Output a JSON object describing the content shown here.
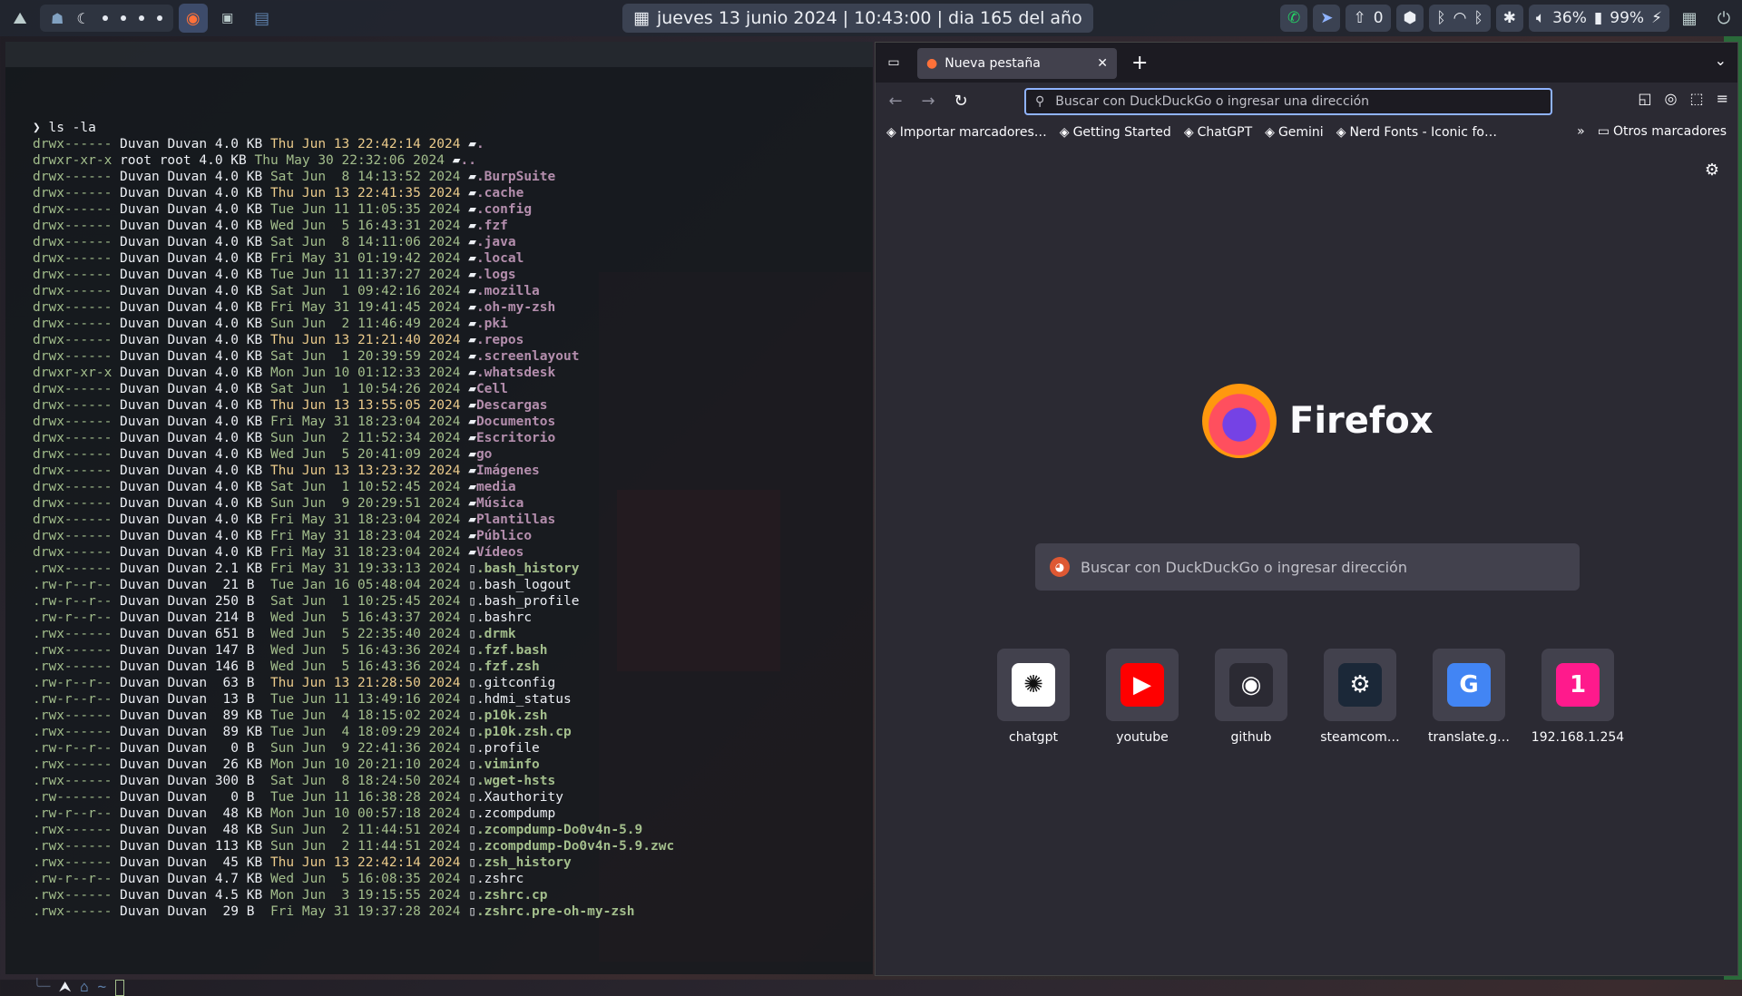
{
  "topbar": {
    "clock": "jueves 13 junio 2024 |  10:43:00 |  dia 165 del año",
    "notifications_count": "0",
    "volume": "36%",
    "battery": "99%"
  },
  "terminal": {
    "command": "❯ ls -la",
    "rows": [
      {
        "perm": "drwx------",
        "owner": "Duvan",
        "group": "Duvan",
        "size": "4.0 KB",
        "date": "Thu Jun 13 22:42:14 2024",
        "name": ".",
        "kind": "dir",
        "today": true
      },
      {
        "perm": "drwxr-xr-x",
        "owner": "root",
        "group": "root",
        "size": "4.0 KB",
        "date": "Thu May 30 22:32:06 2024",
        "name": "..",
        "kind": "dir"
      },
      {
        "perm": "drwx------",
        "owner": "Duvan",
        "group": "Duvan",
        "size": "4.0 KB",
        "date": "Sat Jun  8 14:13:52 2024",
        "name": ".BurpSuite",
        "kind": "dir"
      },
      {
        "perm": "drwx------",
        "owner": "Duvan",
        "group": "Duvan",
        "size": "4.0 KB",
        "date": "Thu Jun 13 22:41:35 2024",
        "name": ".cache",
        "kind": "dir",
        "today": true
      },
      {
        "perm": "drwx------",
        "owner": "Duvan",
        "group": "Duvan",
        "size": "4.0 KB",
        "date": "Tue Jun 11 11:05:35 2024",
        "name": ".config",
        "kind": "dir"
      },
      {
        "perm": "drwx------",
        "owner": "Duvan",
        "group": "Duvan",
        "size": "4.0 KB",
        "date": "Wed Jun  5 16:43:31 2024",
        "name": ".fzf",
        "kind": "dir"
      },
      {
        "perm": "drwx------",
        "owner": "Duvan",
        "group": "Duvan",
        "size": "4.0 KB",
        "date": "Sat Jun  8 14:11:06 2024",
        "name": ".java",
        "kind": "dir"
      },
      {
        "perm": "drwx------",
        "owner": "Duvan",
        "group": "Duvan",
        "size": "4.0 KB",
        "date": "Fri May 31 01:19:42 2024",
        "name": ".local",
        "kind": "dir"
      },
      {
        "perm": "drwx------",
        "owner": "Duvan",
        "group": "Duvan",
        "size": "4.0 KB",
        "date": "Tue Jun 11 11:37:27 2024",
        "name": ".logs",
        "kind": "dir"
      },
      {
        "perm": "drwx------",
        "owner": "Duvan",
        "group": "Duvan",
        "size": "4.0 KB",
        "date": "Sat Jun  1 09:42:16 2024",
        "name": ".mozilla",
        "kind": "dir"
      },
      {
        "perm": "drwx------",
        "owner": "Duvan",
        "group": "Duvan",
        "size": "4.0 KB",
        "date": "Fri May 31 19:41:45 2024",
        "name": ".oh-my-zsh",
        "kind": "dir"
      },
      {
        "perm": "drwx------",
        "owner": "Duvan",
        "group": "Duvan",
        "size": "4.0 KB",
        "date": "Sun Jun  2 11:46:49 2024",
        "name": ".pki",
        "kind": "dir"
      },
      {
        "perm": "drwx------",
        "owner": "Duvan",
        "group": "Duvan",
        "size": "4.0 KB",
        "date": "Thu Jun 13 21:21:40 2024",
        "name": ".repos",
        "kind": "dir",
        "today": true
      },
      {
        "perm": "drwx------",
        "owner": "Duvan",
        "group": "Duvan",
        "size": "4.0 KB",
        "date": "Sat Jun  1 20:39:59 2024",
        "name": ".screenlayout",
        "kind": "dir"
      },
      {
        "perm": "drwxr-xr-x",
        "owner": "Duvan",
        "group": "Duvan",
        "size": "4.0 KB",
        "date": "Mon Jun 10 01:12:33 2024",
        "name": ".whatsdesk",
        "kind": "dir"
      },
      {
        "perm": "drwx------",
        "owner": "Duvan",
        "group": "Duvan",
        "size": "4.0 KB",
        "date": "Sat Jun  1 10:54:26 2024",
        "name": "Cell",
        "kind": "dir"
      },
      {
        "perm": "drwx------",
        "owner": "Duvan",
        "group": "Duvan",
        "size": "4.0 KB",
        "date": "Thu Jun 13 13:55:05 2024",
        "name": "Descargas",
        "kind": "dir",
        "today": true
      },
      {
        "perm": "drwx------",
        "owner": "Duvan",
        "group": "Duvan",
        "size": "4.0 KB",
        "date": "Fri May 31 18:23:04 2024",
        "name": "Documentos",
        "kind": "dir"
      },
      {
        "perm": "drwx------",
        "owner": "Duvan",
        "group": "Duvan",
        "size": "4.0 KB",
        "date": "Sun Jun  2 11:52:34 2024",
        "name": "Escritorio",
        "kind": "dir"
      },
      {
        "perm": "drwx------",
        "owner": "Duvan",
        "group": "Duvan",
        "size": "4.0 KB",
        "date": "Wed Jun  5 20:41:09 2024",
        "name": "go",
        "kind": "dir"
      },
      {
        "perm": "drwx------",
        "owner": "Duvan",
        "group": "Duvan",
        "size": "4.0 KB",
        "date": "Thu Jun 13 13:23:32 2024",
        "name": "Imágenes",
        "kind": "dir",
        "today": true
      },
      {
        "perm": "drwx------",
        "owner": "Duvan",
        "group": "Duvan",
        "size": "4.0 KB",
        "date": "Sat Jun  1 10:52:45 2024",
        "name": "media",
        "kind": "dir"
      },
      {
        "perm": "drwx------",
        "owner": "Duvan",
        "group": "Duvan",
        "size": "4.0 KB",
        "date": "Sun Jun  9 20:29:51 2024",
        "name": "Música",
        "kind": "dir"
      },
      {
        "perm": "drwx------",
        "owner": "Duvan",
        "group": "Duvan",
        "size": "4.0 KB",
        "date": "Fri May 31 18:23:04 2024",
        "name": "Plantillas",
        "kind": "dir"
      },
      {
        "perm": "drwx------",
        "owner": "Duvan",
        "group": "Duvan",
        "size": "4.0 KB",
        "date": "Fri May 31 18:23:04 2024",
        "name": "Público",
        "kind": "dir"
      },
      {
        "perm": "drwx------",
        "owner": "Duvan",
        "group": "Duvan",
        "size": "4.0 KB",
        "date": "Fri May 31 18:23:04 2024",
        "name": "Vídeos",
        "kind": "dir"
      },
      {
        "perm": ".rwx------",
        "owner": "Duvan",
        "group": "Duvan",
        "size": "2.1 KB",
        "date": "Fri May 31 19:33:13 2024",
        "name": ".bash_history",
        "kind": "green"
      },
      {
        "perm": ".rw-r--r--",
        "owner": "Duvan",
        "group": "Duvan",
        "size": " 21 B ",
        "date": "Tue Jan 16 05:48:04 2024",
        "name": ".bash_logout",
        "kind": "file"
      },
      {
        "perm": ".rw-r--r--",
        "owner": "Duvan",
        "group": "Duvan",
        "size": "250 B ",
        "date": "Sat Jun  1 10:25:45 2024",
        "name": ".bash_profile",
        "kind": "file"
      },
      {
        "perm": ".rw-r--r--",
        "owner": "Duvan",
        "group": "Duvan",
        "size": "214 B ",
        "date": "Wed Jun  5 16:43:37 2024",
        "name": ".bashrc",
        "kind": "file"
      },
      {
        "perm": ".rwx------",
        "owner": "Duvan",
        "group": "Duvan",
        "size": "651 B ",
        "date": "Wed Jun  5 22:35:40 2024",
        "name": ".drmk",
        "kind": "green"
      },
      {
        "perm": ".rwx------",
        "owner": "Duvan",
        "group": "Duvan",
        "size": "147 B ",
        "date": "Wed Jun  5 16:43:36 2024",
        "name": ".fzf.bash",
        "kind": "green"
      },
      {
        "perm": ".rwx------",
        "owner": "Duvan",
        "group": "Duvan",
        "size": "146 B ",
        "date": "Wed Jun  5 16:43:36 2024",
        "name": ".fzf.zsh",
        "kind": "green"
      },
      {
        "perm": ".rw-r--r--",
        "owner": "Duvan",
        "group": "Duvan",
        "size": " 63 B ",
        "date": "Thu Jun 13 21:28:50 2024",
        "name": ".gitconfig",
        "kind": "file",
        "today": true
      },
      {
        "perm": ".rw-r--r--",
        "owner": "Duvan",
        "group": "Duvan",
        "size": " 13 B ",
        "date": "Tue Jun 11 13:49:16 2024",
        "name": ".hdmi_status",
        "kind": "file"
      },
      {
        "perm": ".rwx------",
        "owner": "Duvan",
        "group": "Duvan",
        "size": " 89 KB",
        "date": "Tue Jun  4 18:15:02 2024",
        "name": ".p10k.zsh",
        "kind": "green"
      },
      {
        "perm": ".rwx------",
        "owner": "Duvan",
        "group": "Duvan",
        "size": " 89 KB",
        "date": "Tue Jun  4 18:09:29 2024",
        "name": ".p10k.zsh.cp",
        "kind": "green"
      },
      {
        "perm": ".rw-r--r--",
        "owner": "Duvan",
        "group": "Duvan",
        "size": "  0 B ",
        "date": "Sun Jun  9 22:41:36 2024",
        "name": ".profile",
        "kind": "file"
      },
      {
        "perm": ".rwx------",
        "owner": "Duvan",
        "group": "Duvan",
        "size": " 26 KB",
        "date": "Mon Jun 10 20:21:10 2024",
        "name": ".viminfo",
        "kind": "green"
      },
      {
        "perm": ".rwx------",
        "owner": "Duvan",
        "group": "Duvan",
        "size": "300 B ",
        "date": "Sat Jun  8 18:24:50 2024",
        "name": ".wget-hsts",
        "kind": "green"
      },
      {
        "perm": ".rw-------",
        "owner": "Duvan",
        "group": "Duvan",
        "size": "  0 B ",
        "date": "Tue Jun 11 16:38:28 2024",
        "name": ".Xauthority",
        "kind": "file"
      },
      {
        "perm": ".rw-r--r--",
        "owner": "Duvan",
        "group": "Duvan",
        "size": " 48 KB",
        "date": "Mon Jun 10 00:57:18 2024",
        "name": ".zcompdump",
        "kind": "file"
      },
      {
        "perm": ".rwx------",
        "owner": "Duvan",
        "group": "Duvan",
        "size": " 48 KB",
        "date": "Sun Jun  2 11:44:51 2024",
        "name": ".zcompdump-Do0v4n-5.9",
        "kind": "green"
      },
      {
        "perm": ".rwx------",
        "owner": "Duvan",
        "group": "Duvan",
        "size": "113 KB",
        "date": "Sun Jun  2 11:44:51 2024",
        "name": ".zcompdump-Do0v4n-5.9.zwc",
        "kind": "green"
      },
      {
        "perm": ".rwx------",
        "owner": "Duvan",
        "group": "Duvan",
        "size": " 45 KB",
        "date": "Thu Jun 13 22:42:14 2024",
        "name": ".zsh_history",
        "kind": "green",
        "today": true
      },
      {
        "perm": ".rw-r--r--",
        "owner": "Duvan",
        "group": "Duvan",
        "size": "4.7 KB",
        "date": "Wed Jun  5 16:08:35 2024",
        "name": ".zshrc",
        "kind": "file"
      },
      {
        "perm": ".rwx------",
        "owner": "Duvan",
        "group": "Duvan",
        "size": "4.5 KB",
        "date": "Mon Jun  3 19:15:55 2024",
        "name": ".zshrc.cp",
        "kind": "green"
      },
      {
        "perm": ".rwx------",
        "owner": "Duvan",
        "group": "Duvan",
        "size": " 29 B ",
        "date": "Fri May 31 19:37:28 2024",
        "name": ".zshrc.pre-oh-my-zsh",
        "kind": "green"
      }
    ],
    "prompt_home": "~"
  },
  "browser": {
    "tab_title": "Nueva pestaña",
    "url_placeholder": "Buscar con DuckDuckGo o ingresar una dirección",
    "bookmarks": [
      {
        "label": "Importar marcadores…",
        "icon": "import-icon"
      },
      {
        "label": "Getting Started",
        "icon": "firefox-icon"
      },
      {
        "label": "ChatGPT",
        "icon": "chatgpt-icon"
      },
      {
        "label": "Gemini",
        "icon": "globe-icon"
      },
      {
        "label": "Nerd Fonts - Iconic fo…",
        "icon": "nerdfonts-icon"
      }
    ],
    "other_bookmarks": "Otros marcadores",
    "brand": "Firefox",
    "search_placeholder": "Buscar con DuckDuckGo o ingresar dirección",
    "tiles": [
      {
        "label": "chatgpt",
        "glyph": "✺",
        "bg": "#ffffff",
        "fg": "#111111"
      },
      {
        "label": "youtube",
        "glyph": "▶",
        "bg": "#ff0000",
        "fg": "#ffffff"
      },
      {
        "label": "github",
        "glyph": "◉",
        "bg": "#2b2a33",
        "fg": "#ffffff"
      },
      {
        "label": "steamcom…",
        "glyph": "⚙",
        "bg": "#1b2838",
        "fg": "#ffffff"
      },
      {
        "label": "translate.g…",
        "glyph": "G",
        "bg": "#4285f4",
        "fg": "#ffffff"
      },
      {
        "label": "192.168.1.254",
        "glyph": "1",
        "bg": "#ff1a8c",
        "fg": "#ffffff"
      }
    ]
  }
}
